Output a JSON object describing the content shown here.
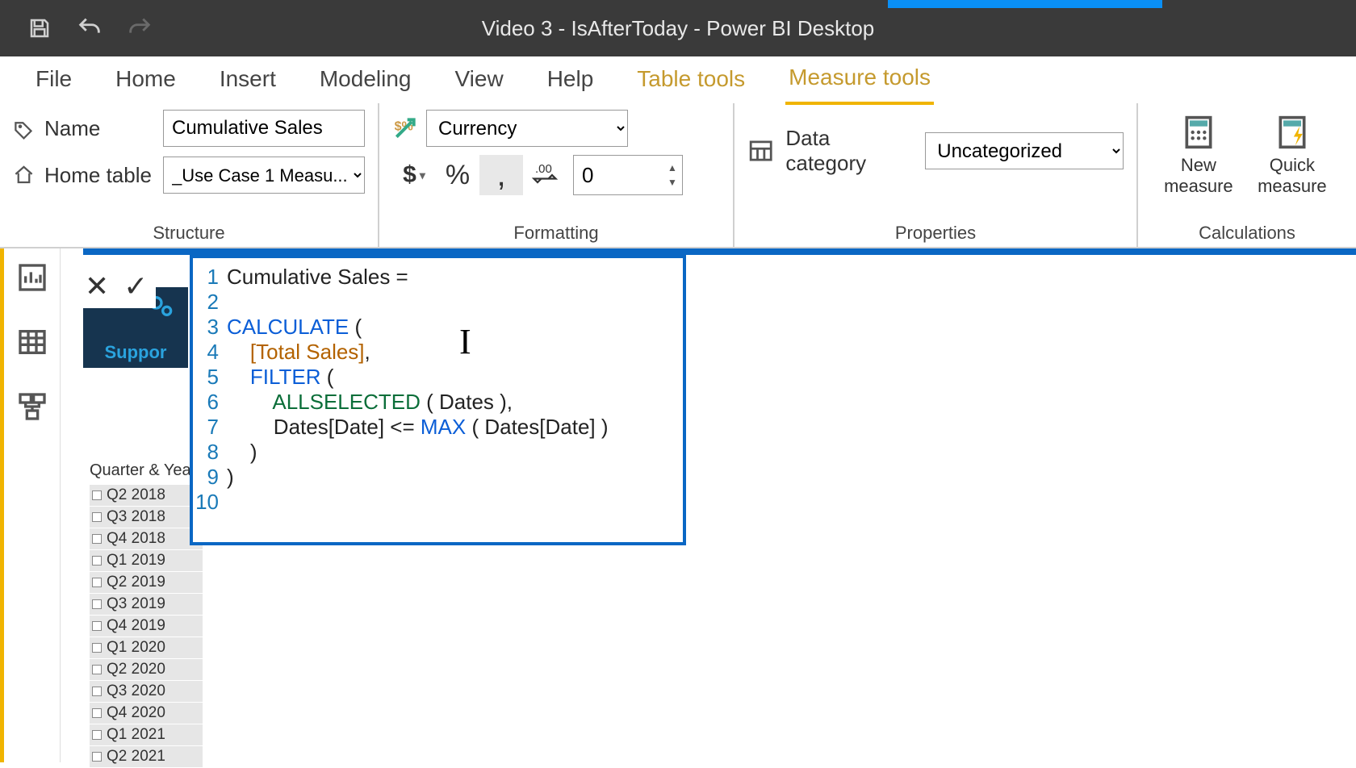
{
  "titlebar": {
    "app_title": "Video 3 - IsAfterToday - Power BI Desktop"
  },
  "ribbon_tabs": {
    "file": "File",
    "home": "Home",
    "insert": "Insert",
    "modeling": "Modeling",
    "view": "View",
    "help": "Help",
    "table_tools": "Table tools",
    "measure_tools": "Measure tools"
  },
  "structure": {
    "name_label": "Name",
    "name_value": "Cumulative Sales",
    "home_table_label": "Home table",
    "home_table_value": "_Use Case 1 Measu...",
    "group_label": "Structure"
  },
  "formatting": {
    "format_value": "Currency",
    "decimals_value": "0",
    "group_label": "Formatting"
  },
  "properties": {
    "data_category_label": "Data category",
    "data_category_value": "Uncategorized",
    "group_label": "Properties"
  },
  "calculations": {
    "new_measure": "New measure",
    "quick_measure": "Quick measure",
    "group_label": "Calculations"
  },
  "support_panel": {
    "label": "Suppor"
  },
  "slicer": {
    "title": "Quarter & Year",
    "items": [
      "Q2 2018",
      "Q3 2018",
      "Q4 2018",
      "Q1 2019",
      "Q2 2019",
      "Q3 2019",
      "Q4 2019",
      "Q1 2020",
      "Q2 2020",
      "Q3 2020",
      "Q4 2020",
      "Q1 2021",
      "Q2 2021"
    ]
  },
  "formula": {
    "lines": [
      {
        "num": "1",
        "tokens": [
          {
            "t": "Cumulative Sales = ",
            "c": "plain"
          }
        ]
      },
      {
        "num": "2",
        "tokens": []
      },
      {
        "num": "3",
        "tokens": [
          {
            "t": "CALCULATE",
            "c": "kw-blue"
          },
          {
            "t": " ( ",
            "c": "plain"
          }
        ]
      },
      {
        "num": "4",
        "tokens": [
          {
            "t": "    ",
            "c": "plain"
          },
          {
            "t": "[Total Sales]",
            "c": "kw-ref"
          },
          {
            "t": ",",
            "c": "plain"
          }
        ]
      },
      {
        "num": "5",
        "tokens": [
          {
            "t": "    ",
            "c": "plain"
          },
          {
            "t": "FILTER",
            "c": "kw-blue"
          },
          {
            "t": " (",
            "c": "plain"
          }
        ]
      },
      {
        "num": "6",
        "tokens": [
          {
            "t": "        ",
            "c": "plain"
          },
          {
            "t": "ALLSELECTED",
            "c": "kw-green"
          },
          {
            "t": " ( Dates ),",
            "c": "plain"
          }
        ]
      },
      {
        "num": "7",
        "tokens": [
          {
            "t": "        Dates[Date] <= ",
            "c": "plain"
          },
          {
            "t": "MAX",
            "c": "kw-blue"
          },
          {
            "t": " ( Dates[Date] )",
            "c": "plain"
          }
        ]
      },
      {
        "num": "8",
        "tokens": [
          {
            "t": "    )",
            "c": "plain"
          }
        ]
      },
      {
        "num": "9",
        "tokens": [
          {
            "t": ")",
            "c": "plain"
          }
        ]
      },
      {
        "num": "10",
        "tokens": []
      }
    ]
  }
}
